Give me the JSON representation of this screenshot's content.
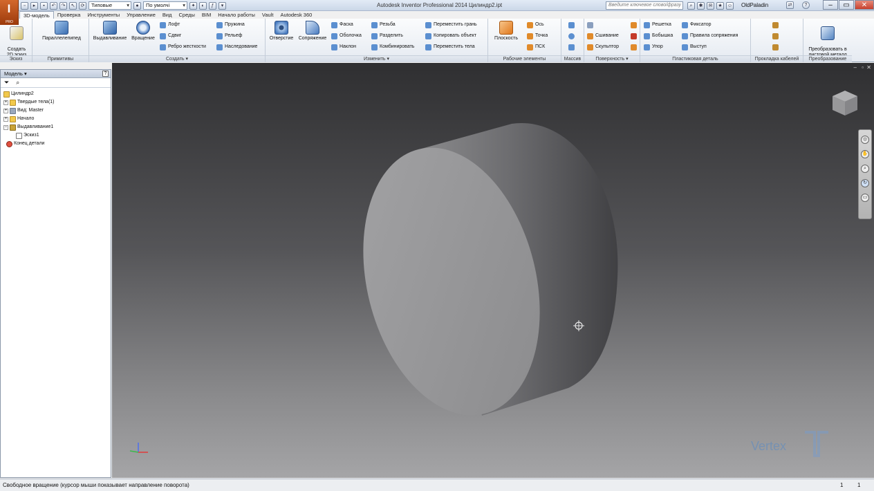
{
  "app": {
    "logo_letter": "I",
    "logo_sub": "PRO",
    "title": "Autodesk Inventor Professional 2014   Цилиндр2.ipt"
  },
  "qat": {
    "material": "Типовые",
    "appearance": "По умолчі",
    "search_placeholder": "Введите ключевое слово/фразу",
    "user": "OldPaladin"
  },
  "tabs": [
    "3D-модель",
    "Проверка",
    "Инструменты",
    "Управление",
    "Вид",
    "Среды",
    "BIM",
    "Начало работы",
    "Vault",
    "Autodesk 360"
  ],
  "ribbon": {
    "sketch": {
      "title": "Эскиз",
      "create": "Создать\n2D эскиз"
    },
    "primitives": {
      "title": "Примитивы",
      "box": "Параллелепипед"
    },
    "create": {
      "title": "Создать ▾",
      "extrude": "Выдавливание",
      "revolve": "Вращение",
      "loft": "Лофт",
      "sweep": "Сдвиг",
      "rib": "Ребро жесткости",
      "coil": "Пружина",
      "emboss": "Рельеф",
      "derive": "Наследование"
    },
    "modify": {
      "title": "Изменить ▾",
      "hole": "Отверстие",
      "fillet": "Сопряжение",
      "chamfer": "Фаска",
      "shell": "Оболочка",
      "draft": "Наклон",
      "thread": "Резьба",
      "split": "Разделить",
      "combine": "Комбинировать",
      "move_face": "Переместить грань",
      "copy_object": "Копировать объект",
      "move_bodies": "Переместить тела"
    },
    "work": {
      "title": "Рабочие элементы",
      "plane": "Плоскость",
      "axis": "Ось",
      "point": "Точка",
      "ucs": "ПСК"
    },
    "pattern": {
      "title": "Массив"
    },
    "surface": {
      "title": "Поверхность ▾",
      "stitch": "Сшивание",
      "sculpt": "Скульптор"
    },
    "plastic": {
      "title": "Пластиковая деталь",
      "grill": "Решетка",
      "boss": "Бобышка",
      "rest": "Упор",
      "snap_fit": "Фиксатор",
      "rule_fillet": "Правила сопряжения",
      "lip": "Выступ"
    },
    "harness": {
      "title": "Прокладка кабелей"
    },
    "convert": {
      "title": "Преобразование",
      "to_sheet": "Преобразовать в\nлистовой металл"
    }
  },
  "browser": {
    "title": "Модель ▾",
    "nodes": [
      "Цилиндр2",
      "Твердые тела(1)",
      "Вид: Master",
      "Начало",
      "Выдавливание1",
      "Эскиз1",
      "Конец детали"
    ]
  },
  "status": {
    "text": "Свободное вращение (курсор мыши показывает направление поворота)",
    "count1": "1",
    "count2": "1"
  },
  "watermark": "Vertex"
}
